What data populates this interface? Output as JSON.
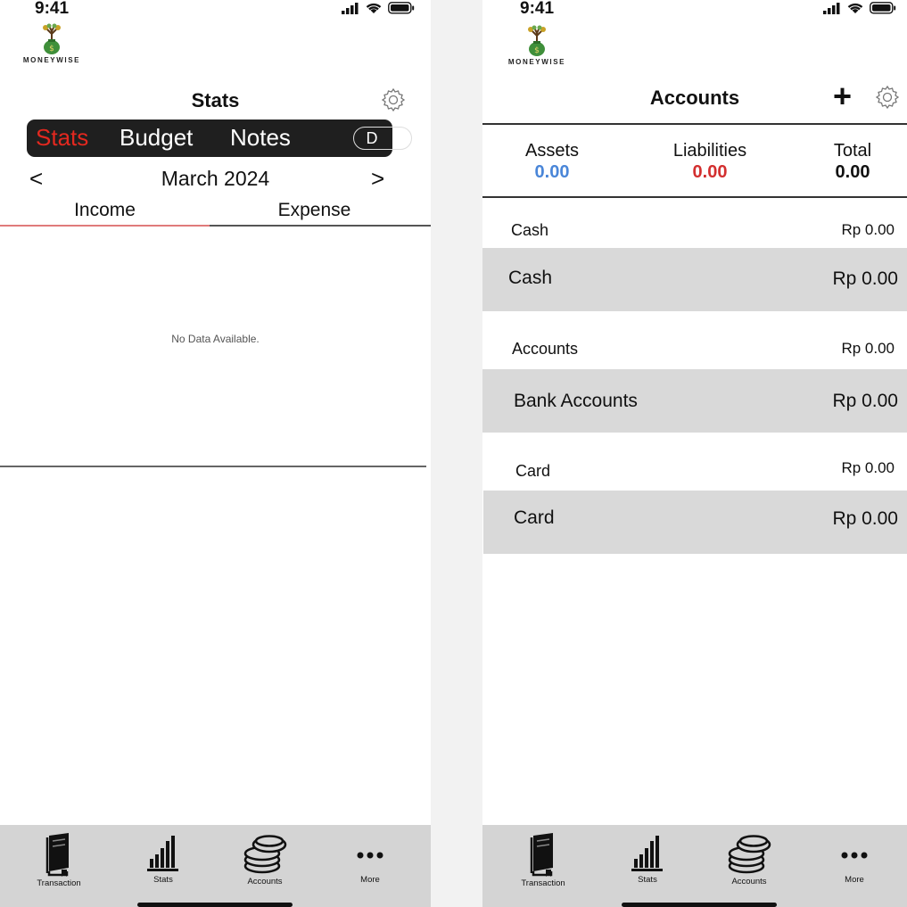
{
  "status": {
    "time": "9:41"
  },
  "brand": {
    "name": "MONEYWISE"
  },
  "stats_screen": {
    "title": "Stats",
    "segments": [
      {
        "label": "Stats",
        "active": true
      },
      {
        "label": "Budget",
        "active": false
      },
      {
        "label": "Notes",
        "active": false
      }
    ],
    "period": {
      "value": "D",
      "chevron": "v"
    },
    "month": {
      "prev": "<",
      "label": "March 2024",
      "next": ">"
    },
    "tabs": [
      {
        "label": "Income",
        "active": true
      },
      {
        "label": "Expense",
        "active": false
      }
    ],
    "empty_message": "No Data  Available."
  },
  "accounts_screen": {
    "title": "Accounts",
    "add_label": "+",
    "summary": {
      "assets": {
        "label": "Assets",
        "value": "0.00",
        "color": "#4a86d8"
      },
      "liabilities": {
        "label": "Liabilities",
        "value": "0.00",
        "color": "#d32f2f"
      },
      "total": {
        "label": "Total",
        "value": "0.00"
      }
    },
    "groups": [
      {
        "name": "Cash",
        "total": "Rp 0.00",
        "items": [
          {
            "name": "Cash",
            "amount": "Rp 0.00"
          }
        ]
      },
      {
        "name": "Accounts",
        "total": "Rp 0.00",
        "items": [
          {
            "name": "Bank Accounts",
            "amount": "Rp 0.00"
          }
        ]
      },
      {
        "name": "Card",
        "total": "Rp 0.00",
        "items": [
          {
            "name": "Card",
            "amount": "Rp 0.00"
          }
        ]
      }
    ]
  },
  "tabbar": {
    "items": [
      {
        "label": "Transaction",
        "icon": "book-icon"
      },
      {
        "label": "Stats",
        "icon": "bar-chart-icon"
      },
      {
        "label": "Accounts",
        "icon": "coins-icon"
      },
      {
        "label": "More",
        "icon": "more-dots-icon"
      }
    ]
  },
  "colors": {
    "accent_red": "#e3281f",
    "segment_bg": "#1f1f1f",
    "row_bg": "#d9d9d9",
    "tabbar_bg": "#d4d4d4"
  }
}
